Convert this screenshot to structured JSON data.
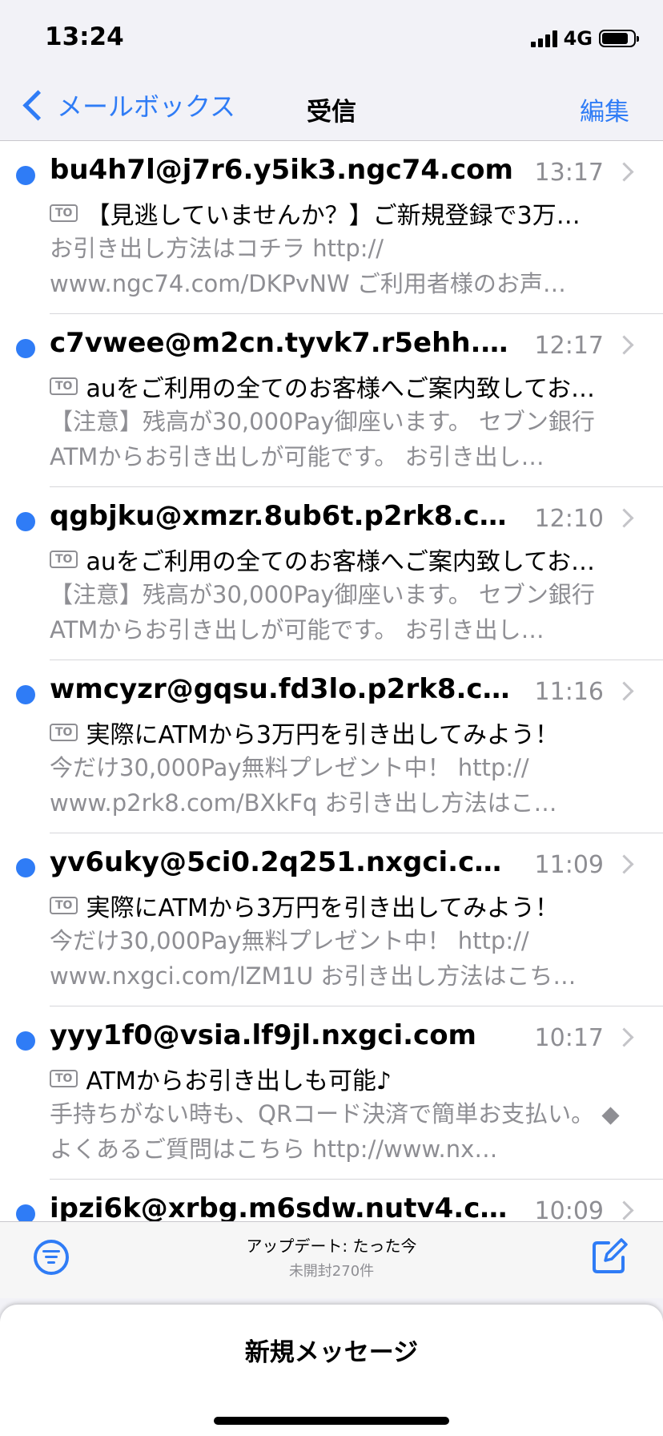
{
  "status_bar": {
    "time": "13:24",
    "network": "4G"
  },
  "nav": {
    "back_label": "メールボックス",
    "title": "受信",
    "edit_label": "編集"
  },
  "mails": [
    {
      "sender": "bu4h7l@j7r6.y5ik3.ngc74.com",
      "time": "13:17",
      "to_badge": "TO",
      "subject": "【見逃していませんか？】ご新規登録で3万…",
      "preview": "お引き出し方法はコチラ http:// www.ngc74.com/DKPvNW ご利用者様のお声…"
    },
    {
      "sender": "c7vwee@m2cn.tyvk7.r5ehh.…",
      "time": "12:17",
      "to_badge": "TO",
      "subject": "auをご利用の全てのお客様へご案内致してお…",
      "preview": "【注意】残高が30,000Pay御座います。 セブン銀行ATMからお引き出しが可能です。 お引き出し…"
    },
    {
      "sender": "qgbjku@xmzr.8ub6t.p2rk8.c…",
      "time": "12:10",
      "to_badge": "TO",
      "subject": "auをご利用の全てのお客様へご案内致してお…",
      "preview": "【注意】残高が30,000Pay御座います。 セブン銀行ATMからお引き出しが可能です。 お引き出し…"
    },
    {
      "sender": "wmcyzr@gqsu.fd3lo.p2rk8.c…",
      "time": "11:16",
      "to_badge": "TO",
      "subject": "実際にATMから3万円を引き出してみよう！",
      "preview": "今だけ30,000Pay無料プレゼント中！ http:// www.p2rk8.com/BXkFq お引き出し方法はこ…"
    },
    {
      "sender": "yv6uky@5ci0.2q251.nxgci.c…",
      "time": "11:09",
      "to_badge": "TO",
      "subject": "実際にATMから3万円を引き出してみよう！",
      "preview": "今だけ30,000Pay無料プレゼント中！ http:// www.nxgci.com/lZM1U お引き出し方法はこち…"
    },
    {
      "sender": "yyy1f0@vsia.lf9jl.nxgci.com",
      "time": "10:17",
      "to_badge": "TO",
      "subject": "ATMからお引き出しも可能♪",
      "preview": "手持ちがない時も、QRコード決済で簡単お支払い。 ◆よくあるご質問はこちら http://www.nx…"
    },
    {
      "sender": "ipzi6k@xrbg.m6sdw.nutv4.c…",
      "time": "10:09",
      "to_badge": "",
      "subject": "",
      "preview": ""
    }
  ],
  "toolbar": {
    "update_text": "アップデート: たった今",
    "unread_text": "未開封270件"
  },
  "sheet": {
    "title": "新規メッセージ"
  },
  "colors": {
    "accent": "#2f7cf6",
    "secondary_text": "#8e8e93"
  },
  "icons": {
    "back": "chevron-left-icon",
    "row": "chevron-right-icon",
    "filter": "filter-icon",
    "compose": "compose-icon"
  }
}
